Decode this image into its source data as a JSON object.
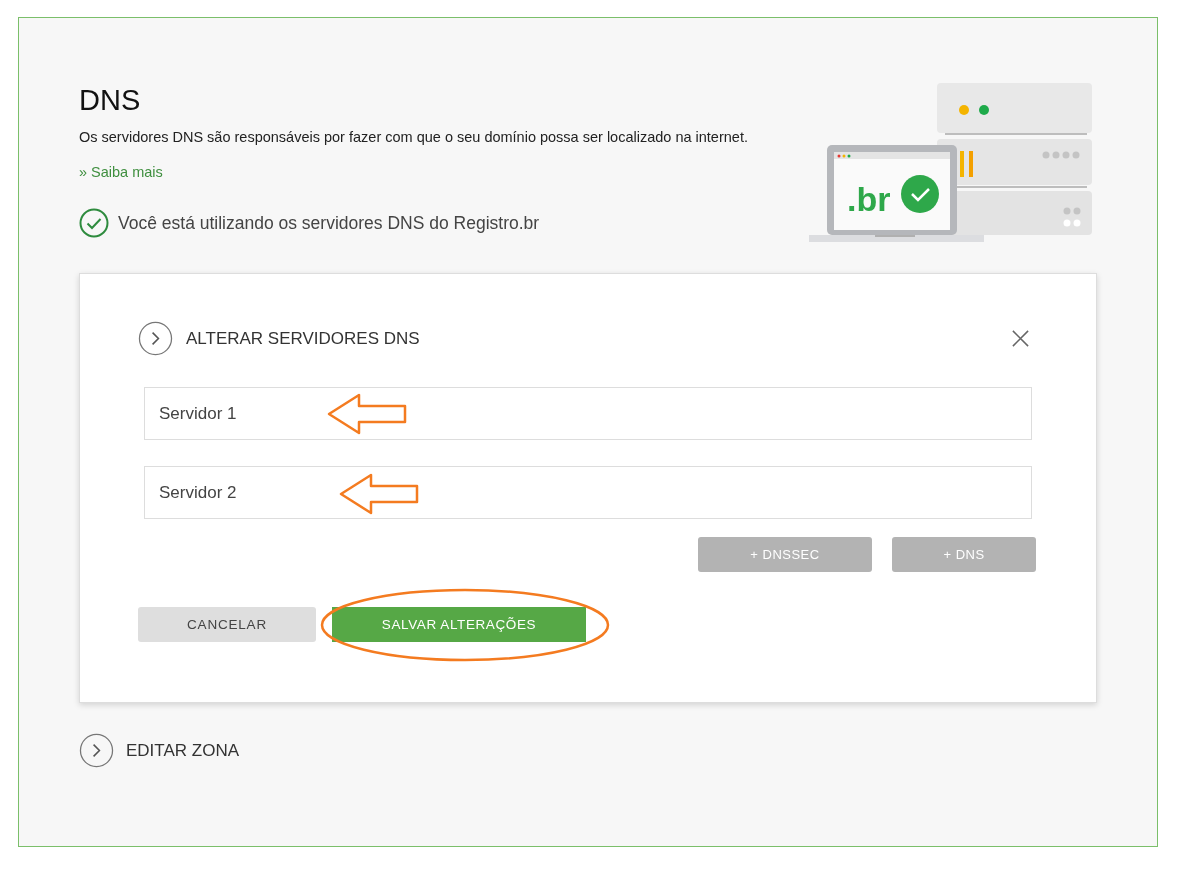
{
  "header": {
    "title": "DNS",
    "description": "Os servidores DNS são responsáveis por fazer com que o seu domínio possa ser localizado na internet.",
    "link": "» Saiba mais",
    "status": "Você está utilizando os servidores DNS do Registro.br"
  },
  "illustration": {
    "screen_text": ".br"
  },
  "panel": {
    "title": "ALTERAR SERVIDORES DNS",
    "expanded": true,
    "fields": [
      {
        "placeholder": "Servidor 1"
      },
      {
        "placeholder": "Servidor 2"
      }
    ],
    "add_buttons": [
      "+ DNSSEC",
      "+ DNS"
    ],
    "cancel": "CANCELAR",
    "save": "SALVAR ALTERAÇÕES"
  },
  "sections": [
    {
      "title": "EDITAR ZONA",
      "expanded": false
    }
  ]
}
